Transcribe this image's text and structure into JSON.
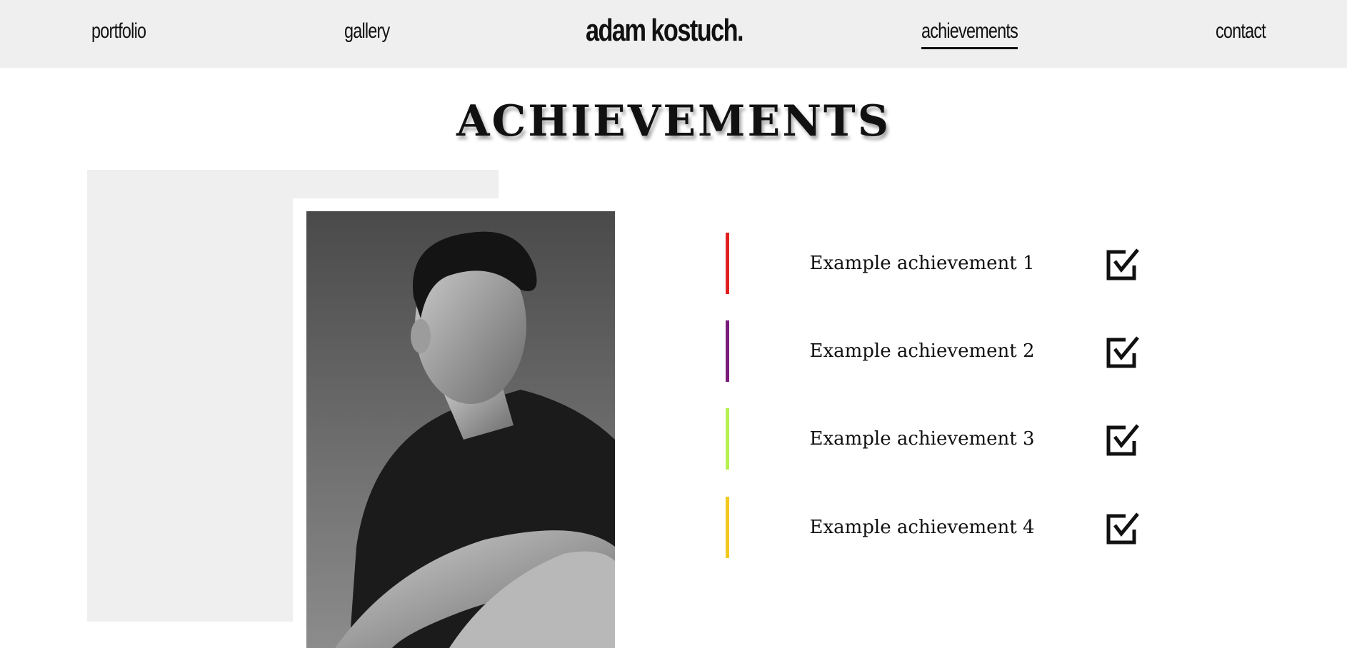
{
  "nav": {
    "links": [
      {
        "label": "portfolio"
      },
      {
        "label": "gallery"
      },
      {
        "label": "achievements",
        "active": true
      },
      {
        "label": "contact"
      }
    ],
    "brand": "adam kostuch."
  },
  "page": {
    "heading": "ACHIEVEMENTS"
  },
  "photo": {
    "description_icon": "portrait-photo"
  },
  "achievements": [
    {
      "label": "Example achievement 1",
      "color": "#e02020",
      "icon": "checkbox-checked-icon"
    },
    {
      "label": "Example achievement 2",
      "color": "#7a1a7a",
      "icon": "checkbox-checked-icon"
    },
    {
      "label": "Example achievement 3",
      "color": "#b6f050",
      "icon": "checkbox-checked-icon"
    },
    {
      "label": "Example achievement 4",
      "color": "#f2c81e",
      "icon": "checkbox-checked-icon"
    }
  ],
  "colors": {
    "nav_bg": "#efefef",
    "page_bg": "#ffffff",
    "text": "#111111"
  }
}
